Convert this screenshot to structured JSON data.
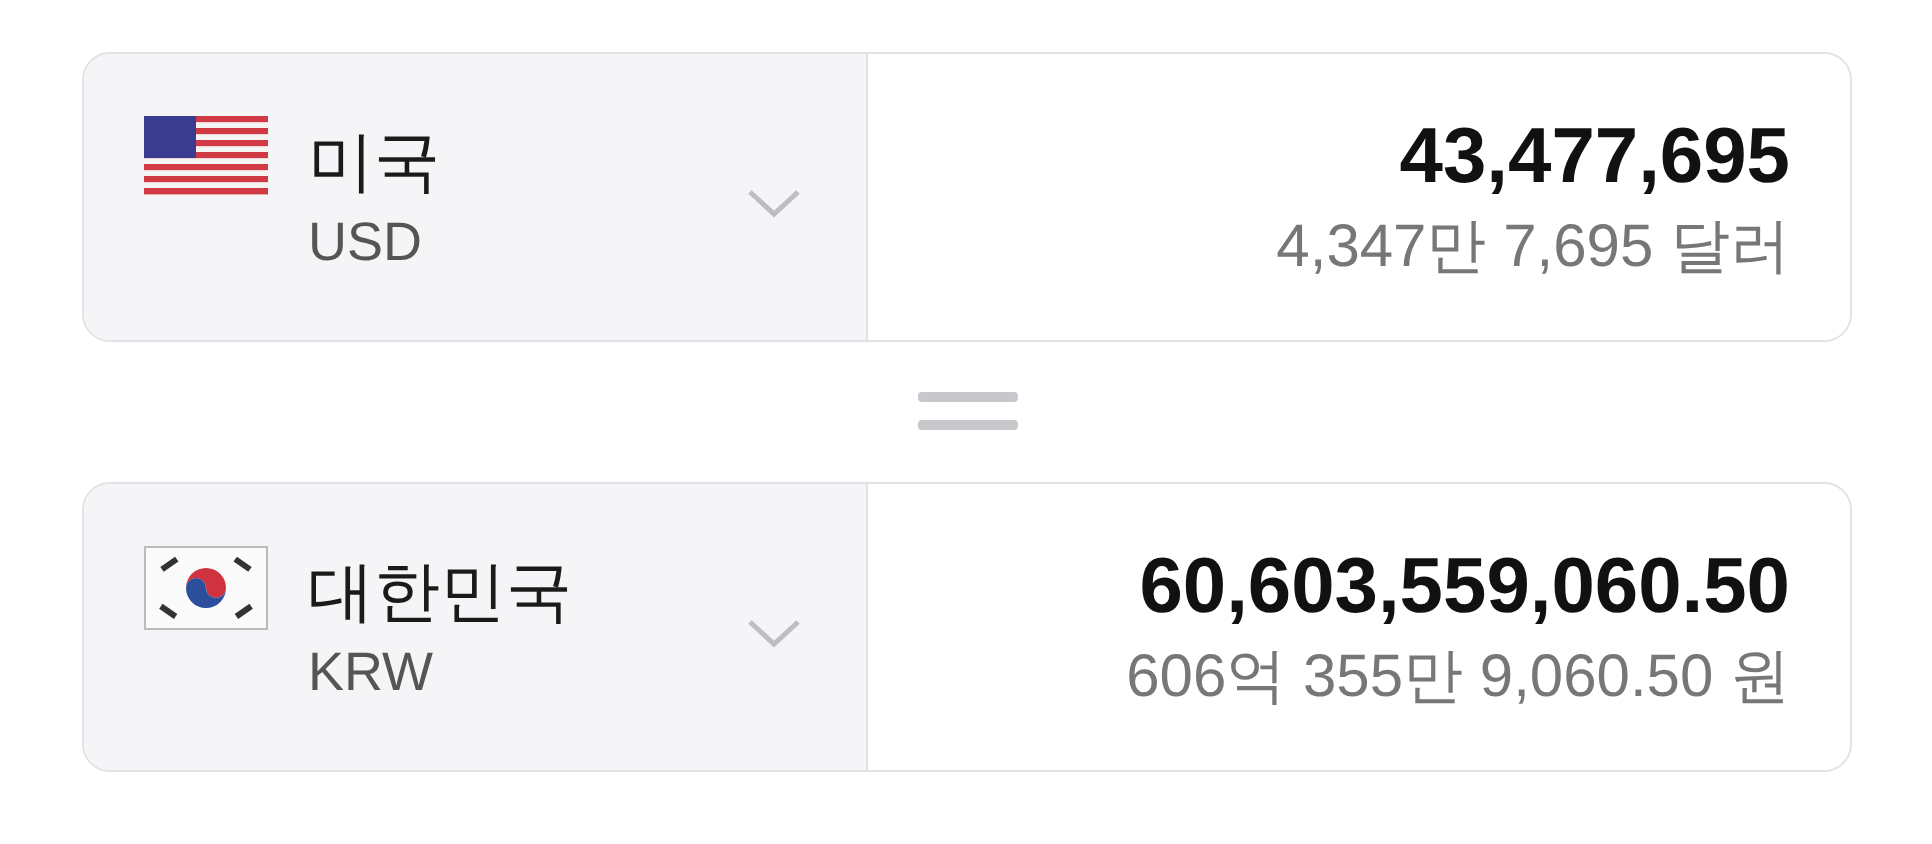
{
  "converters": [
    {
      "kind": "us",
      "country": "미국",
      "code": "USD",
      "amount": "43,477,695",
      "amount_words": "4,347만 7,695 달러"
    },
    {
      "kind": "kr",
      "country": "대한민국",
      "code": "KRW",
      "amount": "60,603,559,060.50",
      "amount_words": "606억 355만 9,060.50 원"
    }
  ]
}
